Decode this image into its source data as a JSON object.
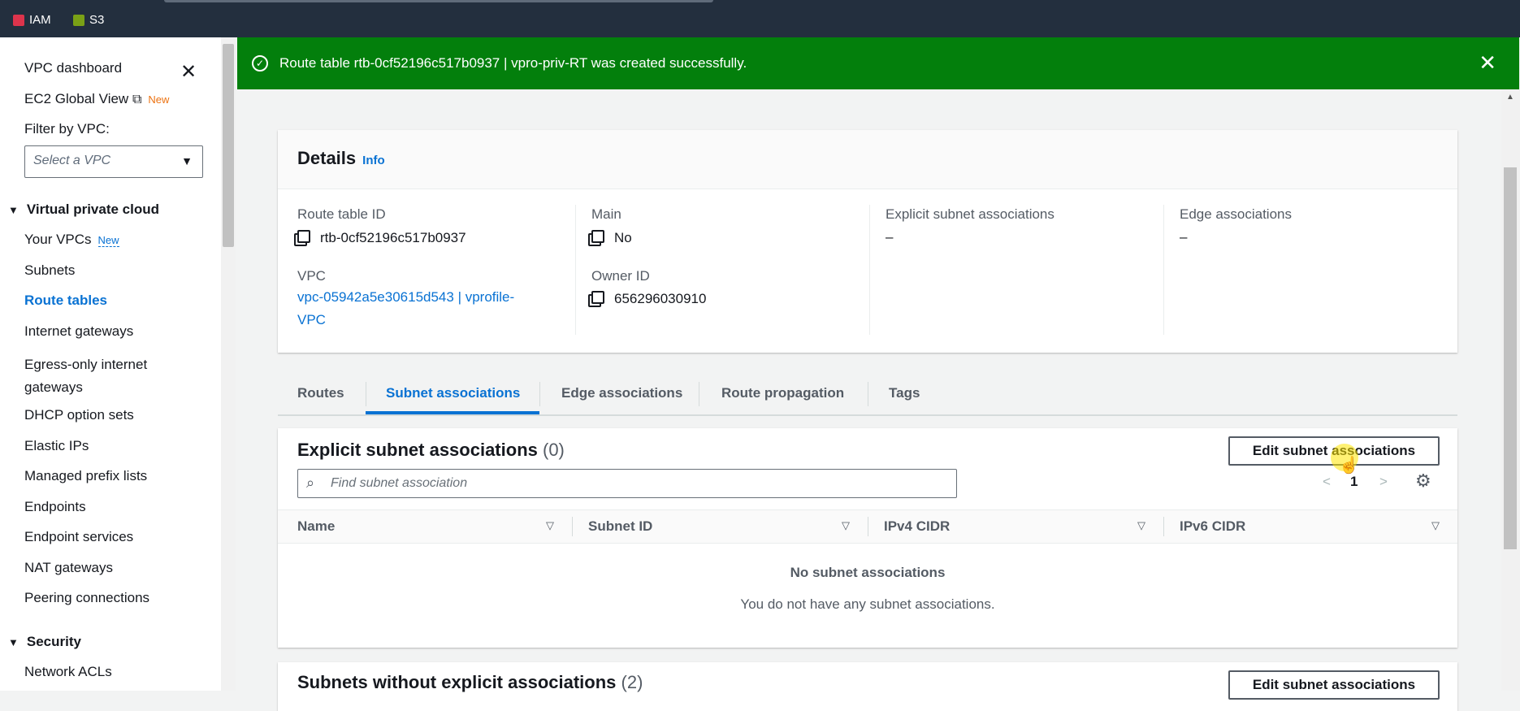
{
  "topbar": {
    "favorites": [
      {
        "label": "IAM",
        "color": "#dd344c"
      },
      {
        "label": "S3",
        "color": "#7aa116"
      }
    ]
  },
  "sidebar": {
    "dashboard": "VPC dashboard",
    "global_view": "EC2 Global View",
    "global_view_badge": "New",
    "filter_label": "Filter by VPC:",
    "filter_placeholder": "Select a VPC",
    "vpc_section": "Virtual private cloud",
    "items": [
      {
        "label": "Your VPCs",
        "badge": "New"
      },
      {
        "label": "Subnets"
      },
      {
        "label": "Route tables",
        "active": true
      },
      {
        "label": "Internet gateways"
      },
      {
        "label": "Egress-only internet gateways"
      },
      {
        "label": "DHCP option sets"
      },
      {
        "label": "Elastic IPs"
      },
      {
        "label": "Managed prefix lists"
      },
      {
        "label": "Endpoints"
      },
      {
        "label": "Endpoint services"
      },
      {
        "label": "NAT gateways"
      },
      {
        "label": "Peering connections"
      }
    ],
    "security_section": "Security",
    "security_items": [
      {
        "label": "Network ACLs"
      }
    ]
  },
  "flash": {
    "message": "Route table rtb-0cf52196c517b0937 | vpro-priv-RT was created successfully.",
    "color": "#037f0c"
  },
  "details": {
    "title": "Details",
    "info": "Info",
    "route_table_id_label": "Route table ID",
    "route_table_id": "rtb-0cf52196c517b0937",
    "vpc_label": "VPC",
    "vpc_line1": "vpc-05942a5e30615d543 | vprofile-",
    "vpc_line2": "VPC",
    "main_label": "Main",
    "main_value": "No",
    "owner_label": "Owner ID",
    "owner_value": "656296030910",
    "explicit_label": "Explicit subnet associations",
    "explicit_value": "–",
    "edge_label": "Edge associations",
    "edge_value": "–"
  },
  "tabs": [
    "Routes",
    "Subnet associations",
    "Edge associations",
    "Route propagation",
    "Tags"
  ],
  "active_tab": "Subnet associations",
  "explicit": {
    "title": "Explicit subnet associations",
    "count": "(0)",
    "edit_button": "Edit subnet associations",
    "search_placeholder": "Find subnet association",
    "page": "1",
    "columns": [
      "Name",
      "Subnet ID",
      "IPv4 CIDR",
      "IPv6 CIDR"
    ],
    "empty_title": "No subnet associations",
    "empty_sub": "You do not have any subnet associations."
  },
  "without": {
    "title": "Subnets without explicit associations",
    "count": "(2)",
    "edit_button": "Edit subnet associations"
  },
  "accent": "#0972d3"
}
